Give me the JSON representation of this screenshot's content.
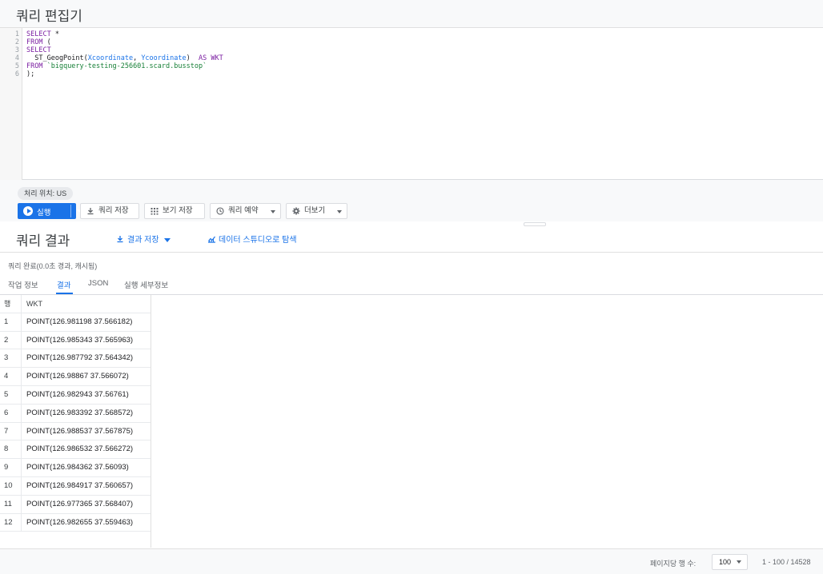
{
  "editor": {
    "title": "쿼리 편집기",
    "line_numbers": [
      "1",
      "2",
      "3",
      "4",
      "5",
      "6"
    ],
    "code": {
      "l1_kw": "SELECT",
      "l1_rest": " *",
      "l2_kw": "FROM",
      "l2_rest": " (",
      "l3_kw": "SELECT",
      "l4_fn": "  ST_GeogPoint(",
      "l4_arg1": "Xcoordinate",
      "l4_comma": ", ",
      "l4_arg2": "Ycoordinate",
      "l4_close": ")  ",
      "l4_as": "AS",
      "l4_alias": " WKT",
      "l5_kw": "FROM",
      "l5_table": " `bigquery-testing-256601.scard.busstop`",
      "l6": ");"
    }
  },
  "toolbar": {
    "location": "처리 위치: US",
    "run_label": "실행",
    "save_query": "쿼리 저장",
    "save_view": "보기 저장",
    "schedule": "쿼리 예약",
    "more": "더보기"
  },
  "results": {
    "title": "쿼리 결과",
    "save_results": "결과 저장",
    "explore": "데이터 스튜디오로 탐색",
    "status": "쿼리 완료(0.0초 경과, 캐시됨)",
    "tabs": [
      "작업 정보",
      "결과",
      "JSON",
      "실행 세부정보"
    ],
    "active_tab": "결과",
    "columns": {
      "index": "행",
      "wkt": "WKT"
    },
    "rows": [
      {
        "i": "1",
        "wkt": "POINT(126.981198 37.566182)"
      },
      {
        "i": "2",
        "wkt": "POINT(126.985343 37.565963)"
      },
      {
        "i": "3",
        "wkt": "POINT(126.987792 37.564342)"
      },
      {
        "i": "4",
        "wkt": "POINT(126.98867 37.566072)"
      },
      {
        "i": "5",
        "wkt": "POINT(126.982943 37.56761)"
      },
      {
        "i": "6",
        "wkt": "POINT(126.983392 37.568572)"
      },
      {
        "i": "7",
        "wkt": "POINT(126.988537 37.567875)"
      },
      {
        "i": "8",
        "wkt": "POINT(126.986532 37.566272)"
      },
      {
        "i": "9",
        "wkt": "POINT(126.984362 37.56093)"
      },
      {
        "i": "10",
        "wkt": "POINT(126.984917 37.560657)"
      },
      {
        "i": "11",
        "wkt": "POINT(126.977365 37.568407)"
      },
      {
        "i": "12",
        "wkt": "POINT(126.982655 37.559463)"
      }
    ]
  },
  "footer": {
    "rows_per_page_label": "페이지당 행 수:",
    "rows_per_page": "100",
    "range": "1 - 100 / 14528"
  },
  "colors": {
    "accent": "#1a73e8",
    "keyword": "#7b1fa2",
    "string": "#188038"
  }
}
